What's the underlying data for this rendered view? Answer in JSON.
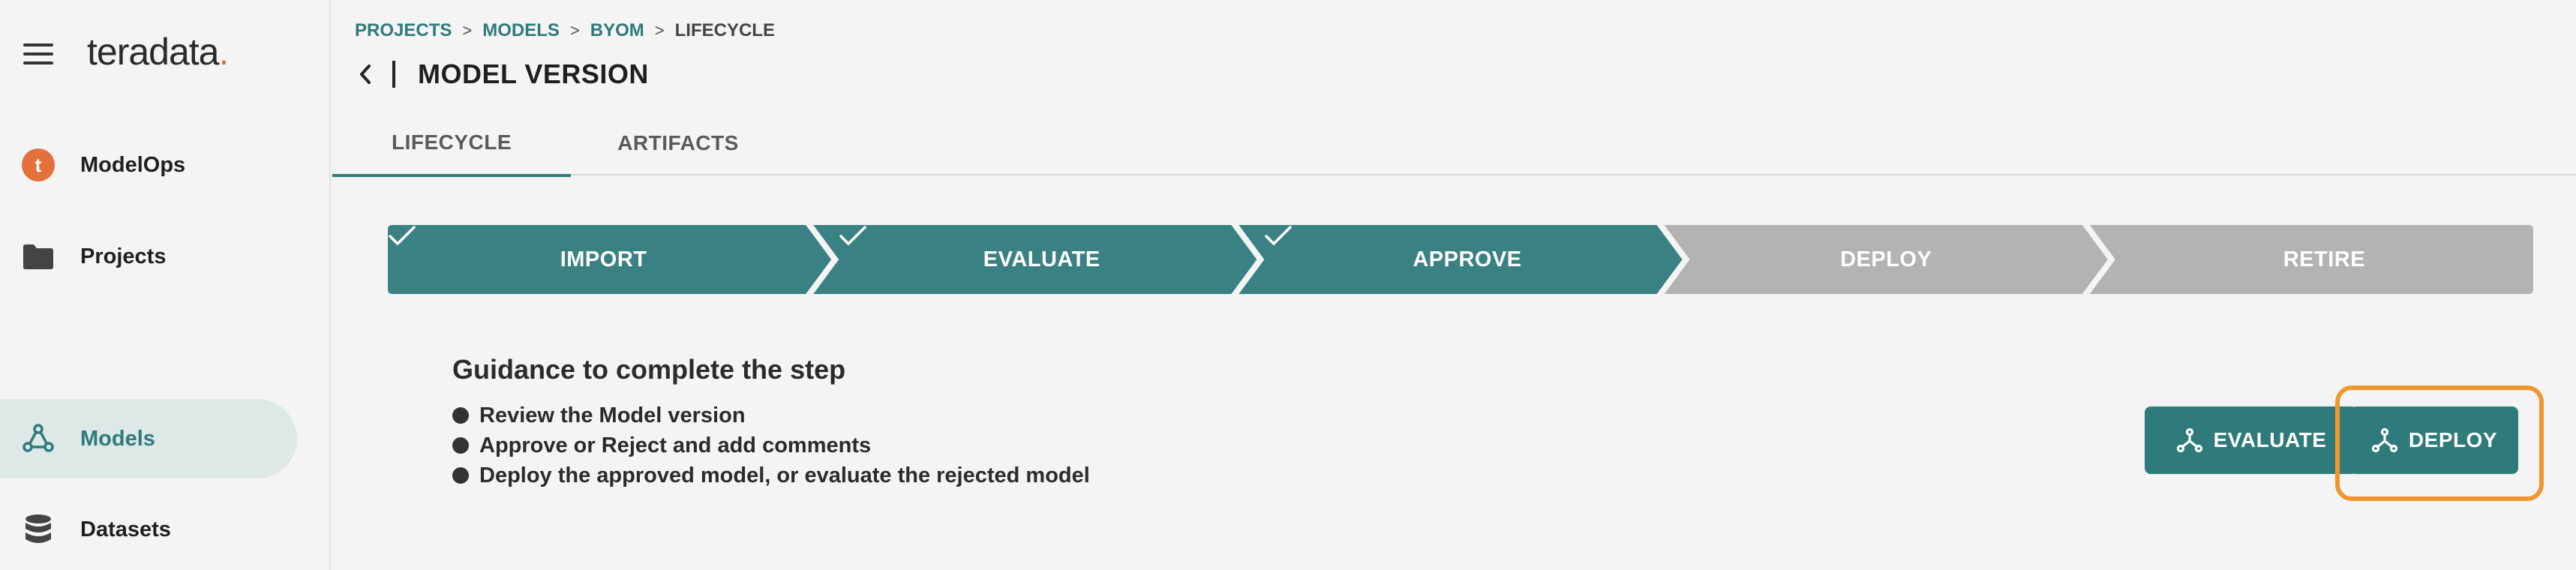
{
  "brand": {
    "name": "teradata",
    "dot": "."
  },
  "sidebar": {
    "items": [
      {
        "label": "ModelOps",
        "icon": "modelops-logo-icon"
      },
      {
        "label": "Projects",
        "icon": "folder-icon"
      },
      {
        "label": "Models",
        "icon": "models-network-icon",
        "active": true
      },
      {
        "label": "Datasets",
        "icon": "database-icon"
      }
    ]
  },
  "breadcrumb": {
    "items": [
      "PROJECTS",
      "MODELS",
      "BYOM"
    ],
    "separator": ">",
    "current": "LIFECYCLE"
  },
  "page": {
    "title": "MODEL VERSION"
  },
  "tabs": [
    {
      "label": "LIFECYCLE",
      "active": true
    },
    {
      "label": "ARTIFACTS",
      "active": false
    }
  ],
  "stepper": {
    "steps": [
      {
        "label": "IMPORT",
        "done": true
      },
      {
        "label": "EVALUATE",
        "done": true
      },
      {
        "label": "APPROVE",
        "done": true
      },
      {
        "label": "DEPLOY",
        "done": false
      },
      {
        "label": "RETIRE",
        "done": false
      }
    ],
    "colors": {
      "done": "#3a8183",
      "pending": "#b3b3b3"
    }
  },
  "guidance": {
    "title": "Guidance to complete the step",
    "items": [
      "Review the Model version",
      "Approve or Reject and add comments",
      "Deploy the approved model, or evaluate the rejected model"
    ]
  },
  "actions": {
    "evaluate_label": "EVALUATE",
    "deploy_label": "DEPLOY",
    "highlight_color": "#f0962e",
    "accent": "#2f7a7b"
  }
}
